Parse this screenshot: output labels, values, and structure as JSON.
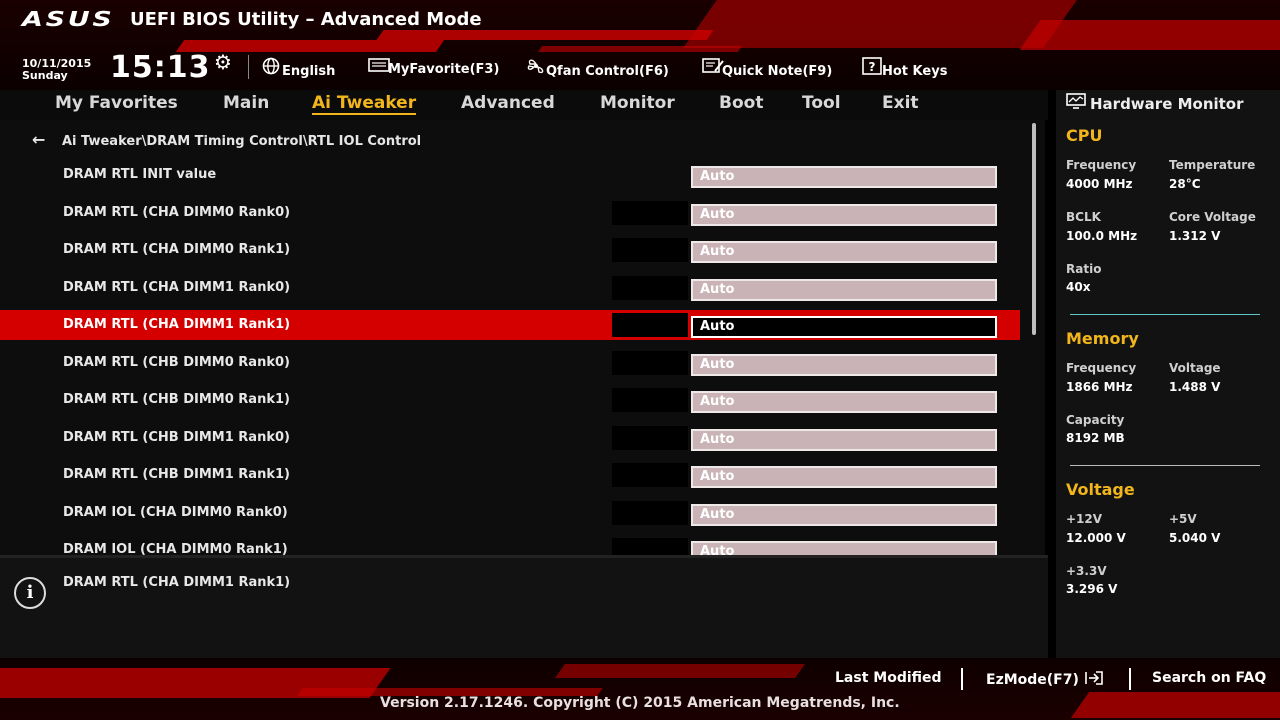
{
  "header": {
    "logo": "ASUS",
    "title": "UEFI BIOS Utility – Advanced Mode",
    "date": "10/11/2015",
    "day": "Sunday",
    "time": "15:13",
    "buttons": [
      {
        "label": "English",
        "icon": "globe-icon"
      },
      {
        "label": "MyFavorite(F3)",
        "icon": "favorite-icon"
      },
      {
        "label": "Qfan Control(F6)",
        "icon": "fan-icon"
      },
      {
        "label": "Quick Note(F9)",
        "icon": "note-icon"
      },
      {
        "label": "Hot Keys",
        "icon": "help-icon"
      }
    ]
  },
  "nav": {
    "tabs": [
      "My Favorites",
      "Main",
      "Ai Tweaker",
      "Advanced",
      "Monitor",
      "Boot",
      "Tool",
      "Exit"
    ],
    "active": "Ai Tweaker"
  },
  "main": {
    "breadcrumb": "Ai Tweaker\\DRAM Timing Control\\RTL IOL Control",
    "rows": [
      {
        "label": "DRAM RTL INIT value",
        "value": "Auto"
      },
      {
        "label": "DRAM RTL (CHA DIMM0 Rank0)",
        "value": "Auto"
      },
      {
        "label": "DRAM RTL (CHA DIMM0 Rank1)",
        "value": "Auto"
      },
      {
        "label": "DRAM RTL (CHA DIMM1 Rank0)",
        "value": "Auto"
      },
      {
        "label": "DRAM RTL (CHA DIMM1 Rank1)",
        "value": "Auto"
      },
      {
        "label": "DRAM RTL (CHB DIMM0 Rank0)",
        "value": "Auto"
      },
      {
        "label": "DRAM RTL (CHB DIMM0 Rank1)",
        "value": "Auto"
      },
      {
        "label": "DRAM RTL (CHB DIMM1 Rank0)",
        "value": "Auto"
      },
      {
        "label": "DRAM RTL (CHB DIMM1 Rank1)",
        "value": "Auto"
      },
      {
        "label": "DRAM IOL (CHA DIMM0 Rank0)",
        "value": "Auto"
      },
      {
        "label": "DRAM IOL (CHA DIMM0 Rank1)",
        "value": "Auto"
      }
    ],
    "selected_index": 4
  },
  "info": {
    "text": "DRAM RTL (CHA DIMM1 Rank1)"
  },
  "hardware_monitor": {
    "title": "Hardware Monitor",
    "cpu": {
      "heading": "CPU",
      "frequency_label": "Frequency",
      "frequency": "4000 MHz",
      "temperature_label": "Temperature",
      "temperature": "28°C",
      "bclk_label": "BCLK",
      "bclk": "100.0 MHz",
      "core_voltage_label": "Core Voltage",
      "core_voltage": "1.312 V",
      "ratio_label": "Ratio",
      "ratio": "40x"
    },
    "memory": {
      "heading": "Memory",
      "frequency_label": "Frequency",
      "frequency": "1866 MHz",
      "voltage_label": "Voltage",
      "voltage": "1.488 V",
      "capacity_label": "Capacity",
      "capacity": "8192 MB"
    },
    "voltage": {
      "heading": "Voltage",
      "v12_label": "+12V",
      "v12": "12.000 V",
      "v5_label": "+5V",
      "v5": "5.040 V",
      "v33_label": "+3.3V",
      "v33": "3.296 V"
    }
  },
  "footer": {
    "last_modified": "Last Modified",
    "ezmode": "EzMode(F7)",
    "search": "Search on FAQ",
    "copyright": "Version 2.17.1246. Copyright (C) 2015 American Megatrends, Inc."
  },
  "colors": {
    "accent": "#f2b61c",
    "selection": "#d40000",
    "value_box": "#c9b3b6",
    "memory_divider": "#5fc6c9"
  }
}
